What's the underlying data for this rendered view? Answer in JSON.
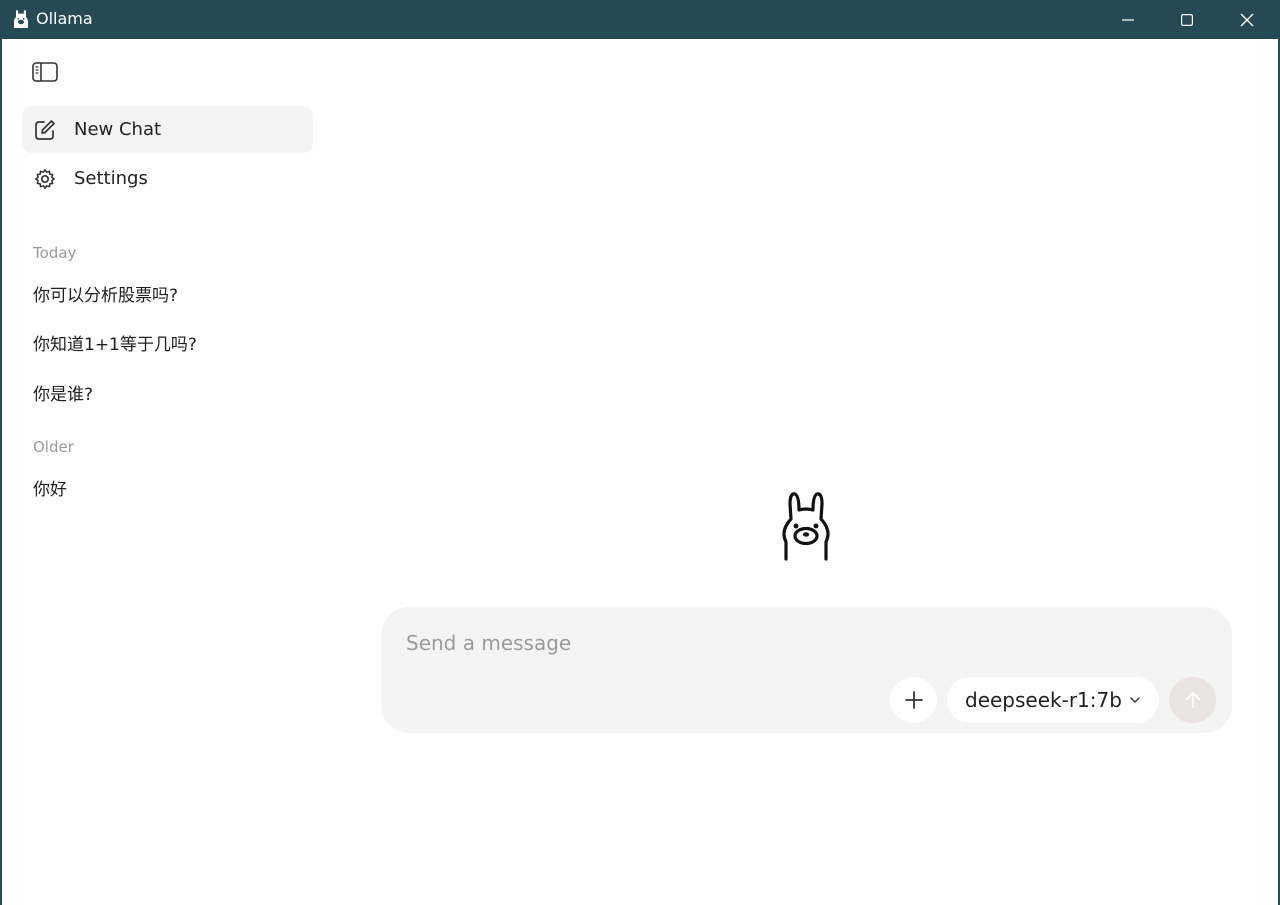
{
  "window": {
    "title": "Ollama"
  },
  "sidebar": {
    "toggle_icon": "sidebar-toggle-icon",
    "nav": [
      {
        "label": "New Chat",
        "icon": "new-chat-icon"
      },
      {
        "label": "Settings",
        "icon": "gear-icon"
      }
    ],
    "sections": [
      {
        "label": "Today",
        "items": [
          "你可以分析股票吗?",
          "你知道1+1等于几吗?",
          "你是谁?"
        ]
      },
      {
        "label": "Older",
        "items": [
          "你好"
        ]
      }
    ]
  },
  "composer": {
    "placeholder": "Send a message",
    "value": "",
    "model": "deepseek-r1:7b"
  },
  "colors": {
    "titlebar": "#264a55",
    "composer_bg": "#f4f4f4",
    "active_nav_bg": "#f4f4f4",
    "send_disabled": "#e9e4e1"
  }
}
